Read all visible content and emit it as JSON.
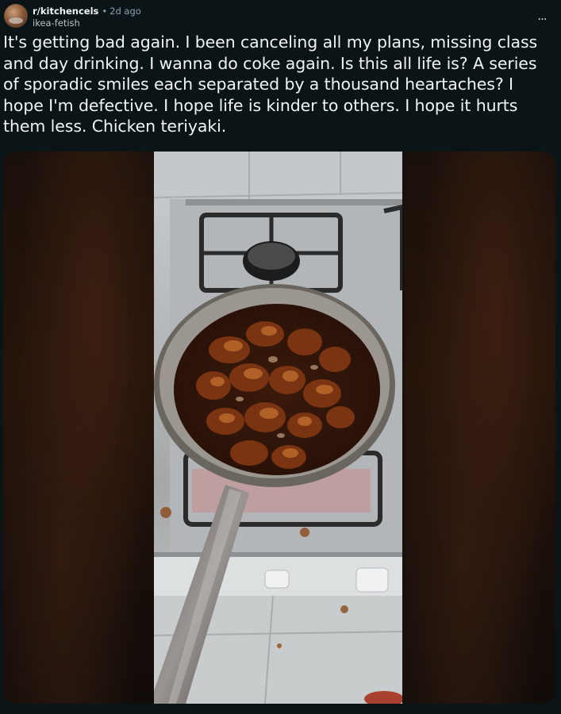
{
  "post": {
    "subreddit": "r/kitchencels",
    "time_ago": "2d ago",
    "username": "ikea-fetish",
    "more_label": "...",
    "title": "It's getting bad again. I been canceling all my plans, missing class and day drinking. I wanna do coke again. Is this all life is? A series of sporadic smiles each separated by a thousand heartaches? I hope I'm defective. I hope life is kinder to others. I hope it hurts them less. Chicken teriyaki."
  },
  "icons": {
    "avatar": "subreddit-avatar",
    "more": "more-options-icon"
  },
  "colors": {
    "background": "#0b1416",
    "text_primary": "#f2f4f5",
    "text_secondary": "#8ba2ad"
  }
}
